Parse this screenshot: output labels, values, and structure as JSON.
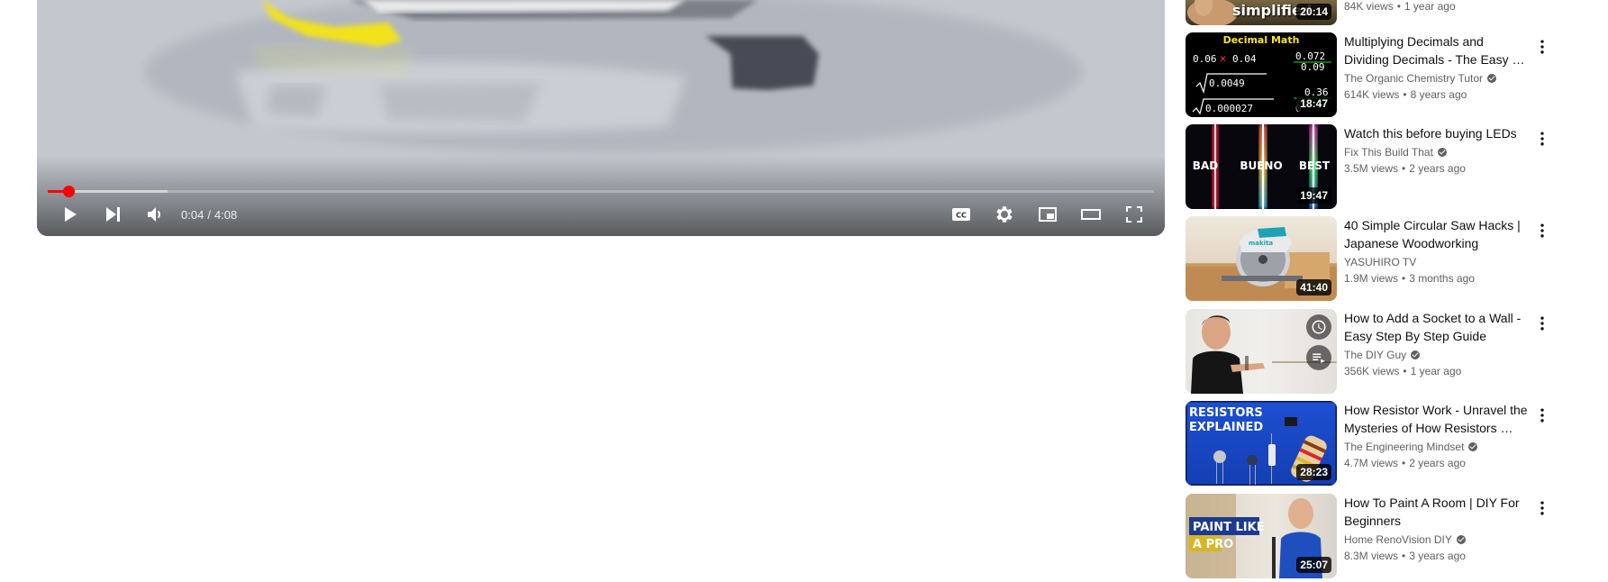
{
  "player": {
    "current_time": "0:04",
    "separator": "/",
    "duration": "4:08",
    "progress_fraction": 0.019,
    "loaded_fraction": 0.108,
    "accent_color": "#ff0000",
    "icons": {
      "play": "play-icon",
      "next": "next-icon",
      "volume": "volume-icon",
      "captions": "captions-icon",
      "settings": "settings-icon",
      "miniplayer": "miniplayer-icon",
      "theater": "theater-icon",
      "fullscreen": "fullscreen-icon"
    }
  },
  "partial_item": {
    "thumb_text": "simplified",
    "duration": "20:14",
    "views": "84K views",
    "age": "1 year ago"
  },
  "recommendations": [
    {
      "title": "Multiplying Decimals and Dividing Decimals - The Easy …",
      "channel": "The Organic Chemistry Tutor",
      "verified": true,
      "views": "614K views",
      "age": "8 years ago",
      "duration": "18:47",
      "thumb_text": {
        "heading": "Decimal Math",
        "a": "0.06",
        "op": "×",
        "b": "0.04",
        "r1": "0.072",
        "r2": "0.09",
        "d1": "0.0049",
        "d2": "0.000027",
        "r3": "0.36",
        "r4": "0"
      }
    },
    {
      "title": "Watch this before buying LEDs",
      "channel": "Fix This Build That",
      "verified": true,
      "views": "3.5M views",
      "age": "2 years ago",
      "duration": "19:47",
      "thumb_text": {
        "a": "BAD",
        "b": "BUENO",
        "c": "BEST"
      }
    },
    {
      "title": "40 Simple Circular Saw Hacks | Japanese Woodworking",
      "channel": "YASUHIRO TV",
      "verified": false,
      "views": "1.9M views",
      "age": "3 months ago",
      "duration": "41:40",
      "thumb_text": {
        "brand": "makita"
      }
    },
    {
      "title": "How to Add a Socket to a Wall - Easy Step By Step Guide",
      "channel": "The DIY Guy",
      "verified": true,
      "views": "356K views",
      "age": "1 year ago",
      "duration": "",
      "hover_icons": [
        "watch-later-icon",
        "add-to-queue-icon"
      ]
    },
    {
      "title": "How Resistor Work - Unravel the Mysteries of How Resistors …",
      "channel": "The Engineering Mindset",
      "verified": true,
      "views": "4.7M views",
      "age": "2 years ago",
      "duration": "28:23",
      "thumb_text": {
        "line1": "RESISTORS",
        "line2": "EXPLAINED"
      }
    },
    {
      "title": "How To Paint A Room | DIY For Beginners",
      "channel": "Home RenoVision DIY",
      "verified": true,
      "views": "8.3M views",
      "age": "3 years ago",
      "duration": "25:07",
      "thumb_text": {
        "line1": "PAINT LIKE",
        "line2": "A PRO"
      }
    }
  ]
}
